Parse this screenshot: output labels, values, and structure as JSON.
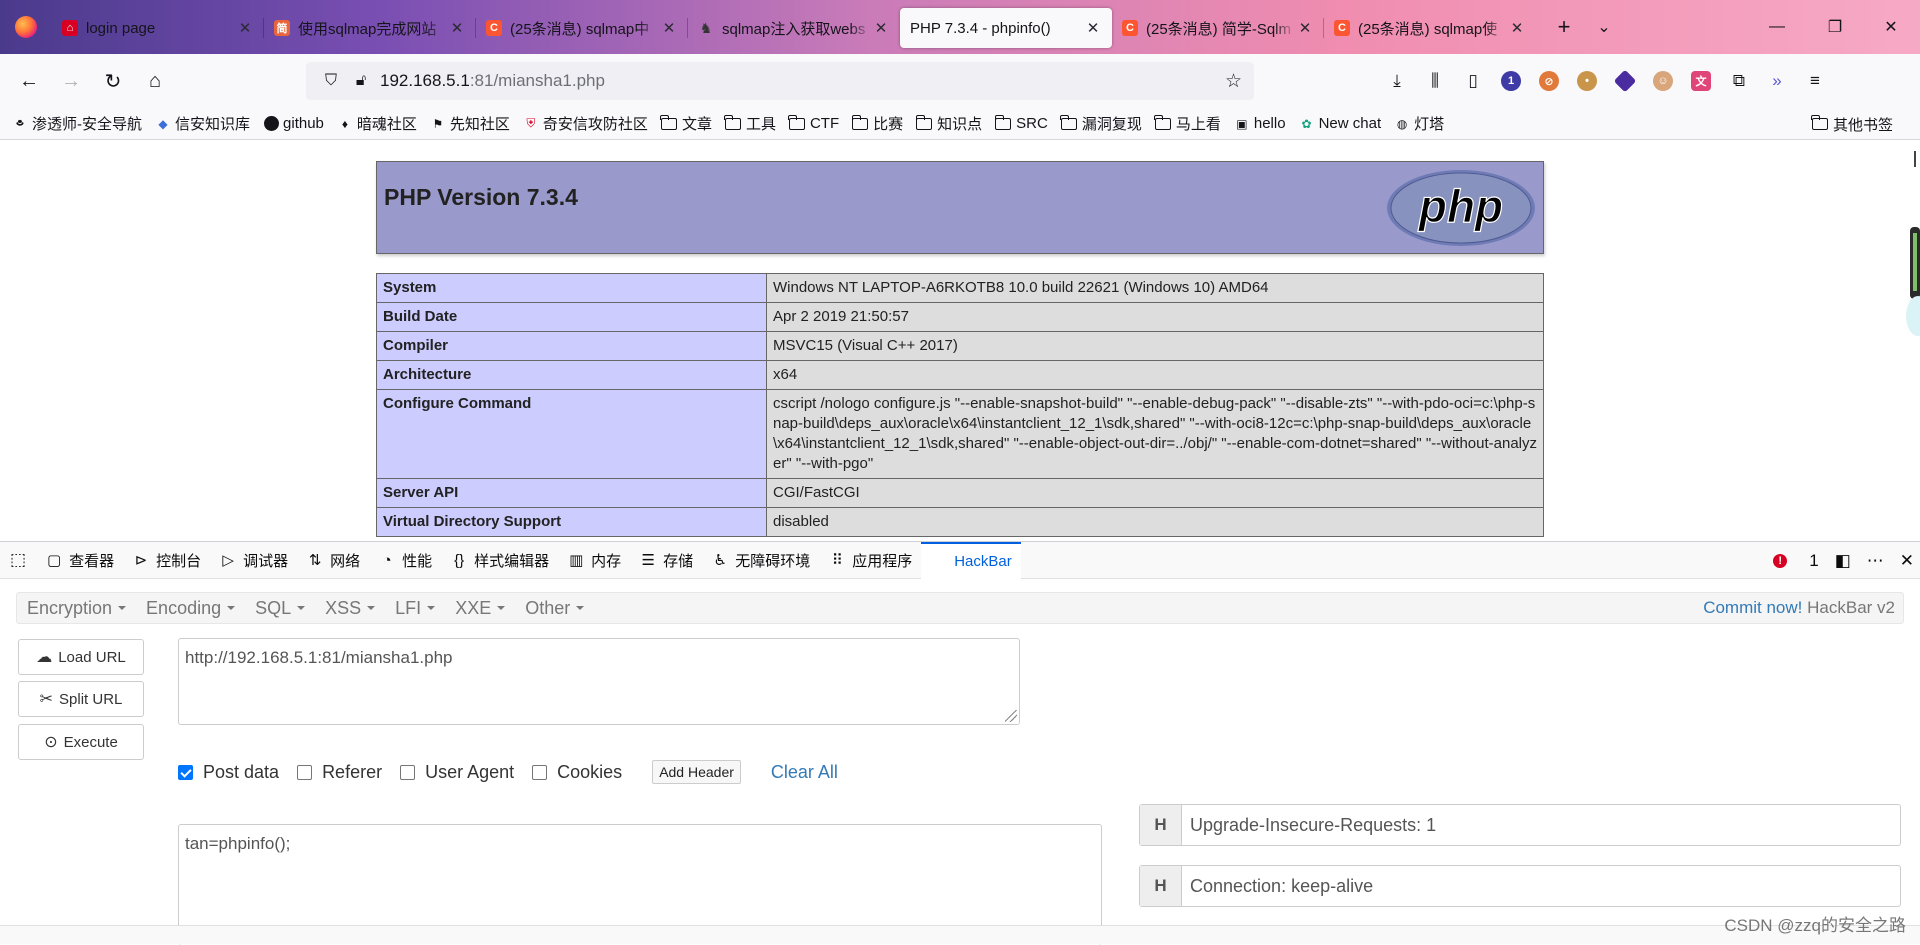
{
  "tabs": [
    {
      "title": "login page",
      "favicon": "red-home-icon",
      "color": "#d70022"
    },
    {
      "title": "使用sqlmap完成网站",
      "favicon": "jian-icon",
      "color": "#e8643a"
    },
    {
      "title": "(25条消息) sqlmap中",
      "favicon": "csdn-icon",
      "color": "#fc5531"
    },
    {
      "title": "sqlmap注入获取webs",
      "favicon": "ghost-icon",
      "color": "#555555"
    },
    {
      "title": "PHP 7.3.4 - phpinfo()",
      "favicon": "",
      "color": ""
    },
    {
      "title": "(25条消息) 简学-Sqlm",
      "favicon": "csdn-icon",
      "color": "#fc5531"
    },
    {
      "title": "(25条消息) sqlmap使",
      "favicon": "csdn-icon",
      "color": "#fc5531"
    }
  ],
  "url": {
    "host": "192.168.5.1",
    "rest": ":81/miansha1.php"
  },
  "bookmarks": [
    {
      "label": "渗透师-安全导航",
      "icon": "hat-icon"
    },
    {
      "label": "信安知识库",
      "icon": "diamond-icon"
    },
    {
      "label": "github",
      "icon": "github-icon"
    },
    {
      "label": "暗魂社区",
      "icon": "flame-icon"
    },
    {
      "label": "先知社区",
      "icon": "flag-icon"
    },
    {
      "label": "奇安信攻防社区",
      "icon": "shield-icon"
    },
    {
      "label": "文章",
      "icon": "folder-icon"
    },
    {
      "label": "工具",
      "icon": "folder-icon"
    },
    {
      "label": "CTF",
      "icon": "folder-icon"
    },
    {
      "label": "比赛",
      "icon": "folder-icon"
    },
    {
      "label": "知识点",
      "icon": "folder-icon"
    },
    {
      "label": "SRC",
      "icon": "folder-icon"
    },
    {
      "label": "漏洞复现",
      "icon": "folder-icon"
    },
    {
      "label": "马上看",
      "icon": "folder-icon"
    },
    {
      "label": "hello",
      "icon": "image-icon"
    },
    {
      "label": "New chat",
      "icon": "chatgpt-icon"
    },
    {
      "label": "灯塔",
      "icon": "globe-icon"
    }
  ],
  "bookmarks_other": "其他书签",
  "php": {
    "title": "PHP Version 7.3.4",
    "logo_text": "php",
    "rows": [
      {
        "k": "System",
        "v": "Windows NT LAPTOP-A6RKOTB8 10.0 build 22621 (Windows 10) AMD64"
      },
      {
        "k": "Build Date",
        "v": "Apr 2 2019 21:50:57"
      },
      {
        "k": "Compiler",
        "v": "MSVC15 (Visual C++ 2017)"
      },
      {
        "k": "Architecture",
        "v": "x64"
      },
      {
        "k": "Configure Command",
        "v": "cscript /nologo configure.js \"--enable-snapshot-build\" \"--enable-debug-pack\" \"--disable-zts\" \"--with-pdo-oci=c:\\php-snap-build\\deps_aux\\oracle\\x64\\instantclient_12_1\\sdk,shared\" \"--with-oci8-12c=c:\\php-snap-build\\deps_aux\\oracle\\x64\\instantclient_12_1\\sdk,shared\" \"--enable-object-out-dir=../obj/\" \"--enable-com-dotnet=shared\" \"--without-analyzer\" \"--with-pgo\""
      },
      {
        "k": "Server API",
        "v": "CGI/FastCGI"
      },
      {
        "k": "Virtual Directory Support",
        "v": "disabled"
      }
    ]
  },
  "devtools": {
    "tabs": [
      {
        "label": "查看器",
        "icon": "inspector-icon"
      },
      {
        "label": "控制台",
        "icon": "console-icon"
      },
      {
        "label": "调试器",
        "icon": "debugger-icon"
      },
      {
        "label": "网络",
        "icon": "network-icon"
      },
      {
        "label": "性能",
        "icon": "performance-icon"
      },
      {
        "label": "样式编辑器",
        "icon": "style-editor-icon"
      },
      {
        "label": "内存",
        "icon": "memory-icon"
      },
      {
        "label": "存储",
        "icon": "storage-icon"
      },
      {
        "label": "无障碍环境",
        "icon": "accessibility-icon"
      },
      {
        "label": "应用程序",
        "icon": "application-icon"
      },
      {
        "label": "HackBar",
        "icon": "hackbar-icon"
      }
    ],
    "error_count": "1"
  },
  "hackbar": {
    "menus": [
      "Encryption",
      "Encoding",
      "SQL",
      "XSS",
      "LFI",
      "XXE",
      "Other"
    ],
    "commit_link": "Commit now!",
    "version": "HackBar v2",
    "buttons": {
      "load": "Load URL",
      "split": "Split URL",
      "execute": "Execute"
    },
    "url_value": "http://192.168.5.1:81/miansha1.php",
    "options": [
      {
        "label": "Post data",
        "checked": true
      },
      {
        "label": "Referer",
        "checked": false
      },
      {
        "label": "User Agent",
        "checked": false
      },
      {
        "label": "Cookies",
        "checked": false
      }
    ],
    "add_header": "Add Header",
    "clear_all": "Clear All",
    "post_value": "tan=phpinfo();",
    "headers": [
      {
        "tag": "H",
        "value": "Upgrade-Insecure-Requests: 1"
      },
      {
        "tag": "H",
        "value": "Connection: keep-alive"
      }
    ]
  },
  "watermark": "CSDN @zzq的安全之路"
}
